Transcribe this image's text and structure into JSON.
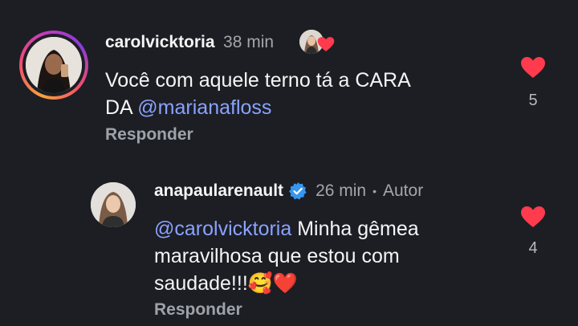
{
  "colors": {
    "background": "#1c1e24",
    "mention": "#8aa2ff",
    "heart": "#ff3b4d",
    "verified": "#3797f0"
  },
  "comments": [
    {
      "username": "carolvicktoria",
      "time": "38 min",
      "text_before": "Você com aquele terno tá a CARA",
      "text_line2_prefix": "DA ",
      "mention": "@marianafloss",
      "reply_label": "Responder",
      "likes": "5",
      "icons": [
        "story-ring",
        "author-liked-avatar",
        "heart-icon"
      ]
    },
    {
      "username": "anapaularenault",
      "time": "26 min",
      "separator": "•",
      "author_tag": "Autor",
      "mention": "@carolvicktoria",
      "text_line1": " Minha gêmea",
      "text_line2": "maravilhosa que estou com",
      "text_line3": "saudade!!!",
      "emoji": "🥰❤️",
      "reply_label": "Responder",
      "likes": "4",
      "icons": [
        "verified-badge-icon",
        "heart-icon"
      ]
    }
  ]
}
